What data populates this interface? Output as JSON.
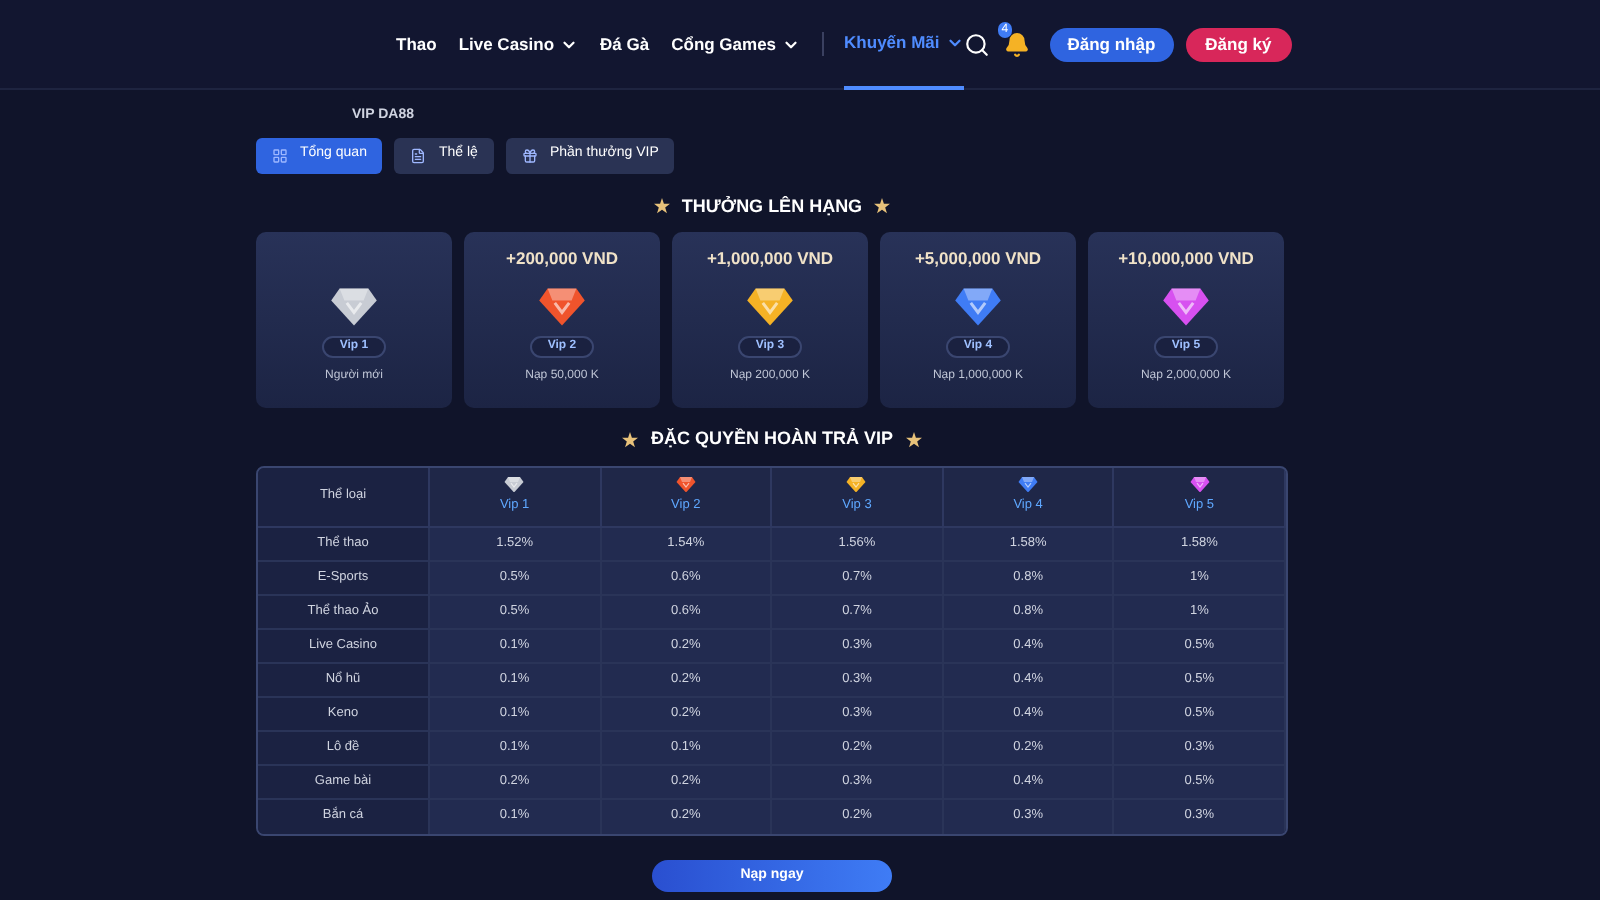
{
  "nav": {
    "items": [
      {
        "label": "Thao",
        "dropdown": false,
        "selected": false
      },
      {
        "label": "Live Casino",
        "dropdown": true,
        "selected": false
      },
      {
        "label": "Đá Gà",
        "dropdown": false,
        "selected": false
      },
      {
        "label": "Cổng Games",
        "dropdown": true,
        "selected": false
      },
      {
        "label": "Khuyến Mãi",
        "dropdown": true,
        "selected": true
      }
    ],
    "notification_count": "4",
    "login": "Đăng nhập",
    "register": "Đăng ký"
  },
  "breadcrumb": "VIP DA88",
  "tabs": [
    {
      "label": "Tổng quan",
      "selected": true,
      "kind": "grid"
    },
    {
      "label": "Thể lệ",
      "selected": false,
      "kind": "doc"
    },
    {
      "label": "Phần thưởng VIP",
      "selected": false,
      "kind": "gift"
    }
  ],
  "upgrade": {
    "title": "THƯỞNG LÊN HẠNG",
    "cards": [
      {
        "level": "Vip 1",
        "requirement": "Người mới",
        "color": "#c8ccd4"
      },
      {
        "bonus": "+200,000 VND",
        "level": "Vip 2",
        "requirement": "Nạp 50,000 K",
        "color": "#f0542c"
      },
      {
        "bonus": "+1,000,000 VND",
        "level": "Vip 3",
        "requirement": "Nạp 200,000 K",
        "color": "#f5b225"
      },
      {
        "bonus": "+5,000,000 VND",
        "level": "Vip 4",
        "requirement": "Nạp 1,000,000 K",
        "color": "#3f7cf5"
      },
      {
        "bonus": "+10,000,000 VND",
        "level": "Vip 5",
        "requirement": "Nạp 2,000,000 K",
        "color": "#d750f0"
      }
    ]
  },
  "cashback": {
    "title": "ĐẶC QUYỀN HOÀN TRẢ VIP",
    "columns": [
      {
        "label": "Thể loại"
      },
      {
        "label": "Vip 1",
        "color": "#c8ccd4"
      },
      {
        "label": "Vip 2",
        "color": "#f0542c"
      },
      {
        "label": "Vip 3",
        "color": "#f5b225"
      },
      {
        "label": "Vip 4",
        "color": "#3f7cf5"
      },
      {
        "label": "Vip 5",
        "color": "#d750f0"
      }
    ],
    "rows": [
      [
        "Thể thao",
        "1.52%",
        "1.54%",
        "1.56%",
        "1.58%",
        "1.58%"
      ],
      [
        "E-Sports",
        "0.5%",
        "0.6%",
        "0.7%",
        "0.8%",
        "1%"
      ],
      [
        "Thể thao Ảo",
        "0.5%",
        "0.6%",
        "0.7%",
        "0.8%",
        "1%"
      ],
      [
        "Live Casino",
        "0.1%",
        "0.2%",
        "0.3%",
        "0.4%",
        "0.5%"
      ],
      [
        "Nổ hũ",
        "0.1%",
        "0.2%",
        "0.3%",
        "0.4%",
        "0.5%"
      ],
      [
        "Keno",
        "0.1%",
        "0.2%",
        "0.3%",
        "0.4%",
        "0.5%"
      ],
      [
        "Lô đề",
        "0.1%",
        "0.1%",
        "0.2%",
        "0.2%",
        "0.3%"
      ],
      [
        "Game bài",
        "0.2%",
        "0.2%",
        "0.3%",
        "0.4%",
        "0.5%"
      ],
      [
        "Bắn cá",
        "0.1%",
        "0.2%",
        "0.2%",
        "0.3%",
        "0.3%"
      ]
    ]
  },
  "deposit_button": "Nạp ngay"
}
